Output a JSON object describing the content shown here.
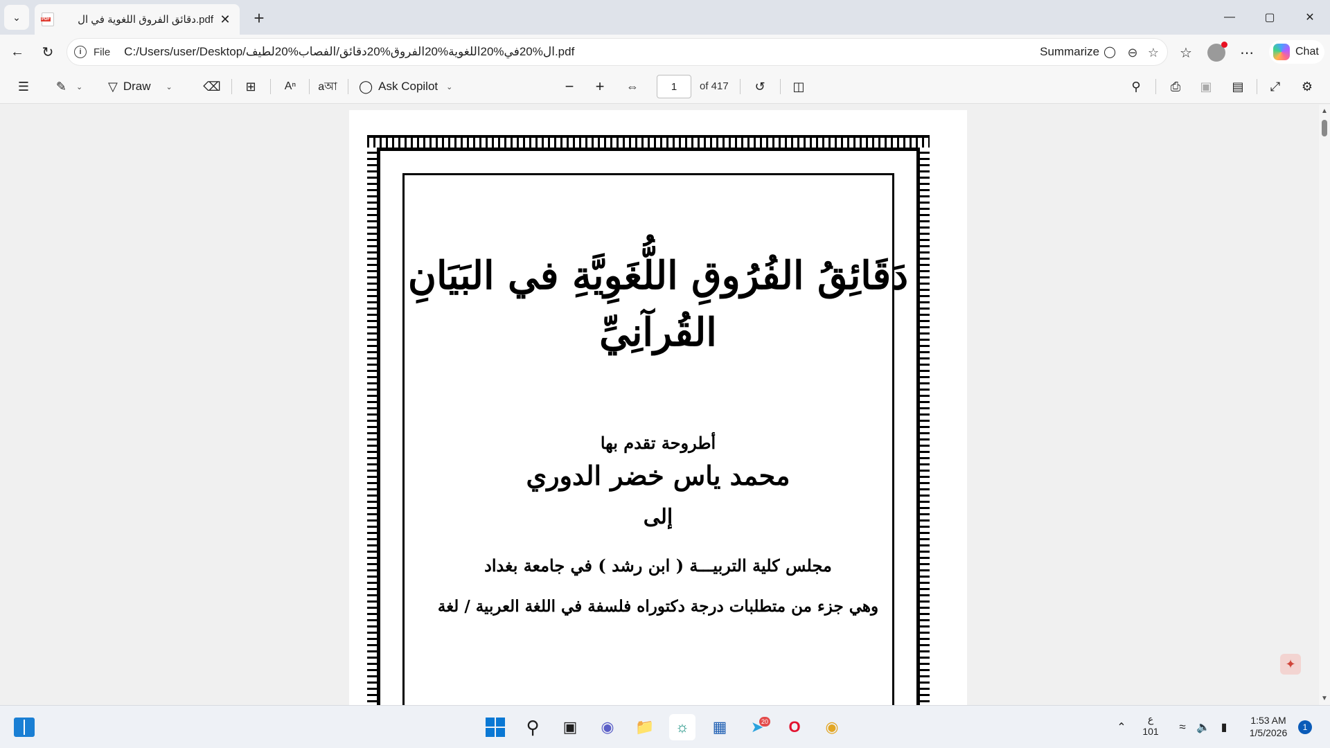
{
  "tab": {
    "title": "دقائق الفروق اللغوية في ال.pdf",
    "close": "✕",
    "new_tab": "+"
  },
  "window": {
    "minimize": "—",
    "maximize": "▢",
    "close": "✕"
  },
  "address": {
    "scheme": "File",
    "url": "C:/Users/user/Desktop/ال%20في%20اللغوية%20الفروق%20دقائق/الفصاب%20لطيف.pdf",
    "summarize": "Summarize",
    "chat": "Chat"
  },
  "pdf_toolbar": {
    "draw": "Draw",
    "ask_copilot": "Ask Copilot",
    "page_number": "1",
    "page_count": "of 417"
  },
  "document": {
    "title": "دَقَائِقُ الفُرُوقِ اللُّغَوِيَّةِ في البَيَانِ القُرآنِيِّ",
    "line1": "أطروحة تقدم بها",
    "author": "محمد ياس خضر الدوري",
    "to": "إلى",
    "council": "مجلس كلية التربيـــة ( ابن رشد ) في جامعة بغداد",
    "degree": "وهي جزء من متطلبات درجة دكتوراه فلسفة في اللغة العربية / لغة"
  },
  "taskbar": {
    "lang_line1": "ع",
    "lang_line2": "101",
    "time": "1:53 AM",
    "date": "1/5/2026",
    "notifications": "1",
    "telegram_badge": "20"
  }
}
